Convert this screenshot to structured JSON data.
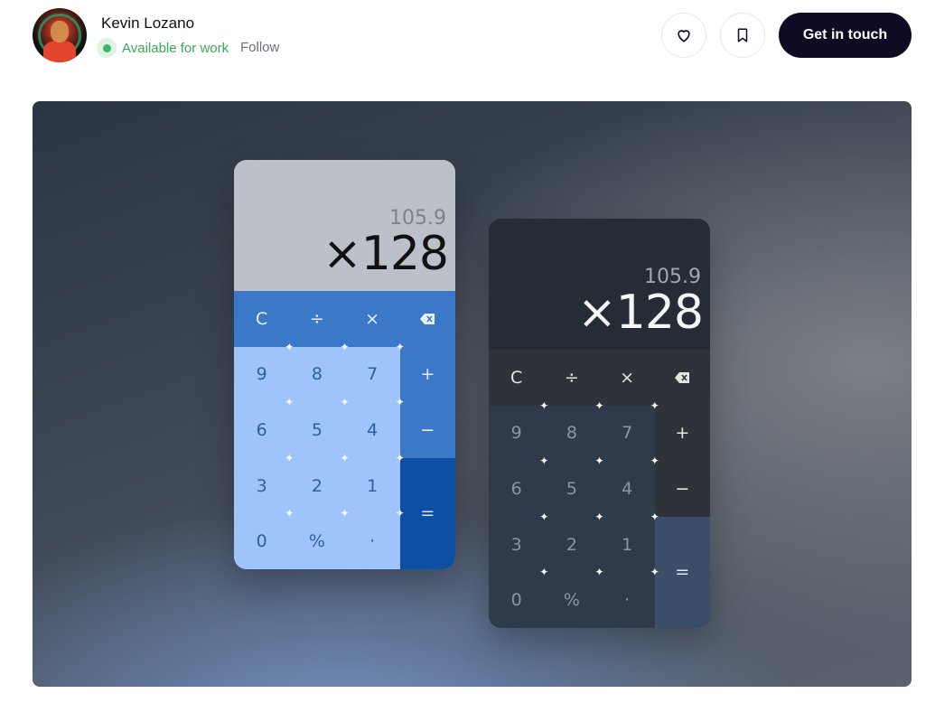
{
  "header": {
    "designer_name": "Kevin Lozano",
    "availability": "Available for work",
    "follow_label": "Follow",
    "cta_label": "Get in touch"
  },
  "shot": {
    "calc_light": {
      "previous": "105.9",
      "result": "×128",
      "keys": [
        "C",
        "÷",
        "×",
        "⌫",
        "9",
        "8",
        "7",
        "+",
        "6",
        "5",
        "4",
        "−",
        "3",
        "2",
        "1",
        "=",
        "0",
        "%",
        "·"
      ]
    },
    "calc_dark": {
      "previous": "105.9",
      "result": "×128",
      "keys": [
        "C",
        "÷",
        "×",
        "⌫",
        "9",
        "8",
        "7",
        "+",
        "6",
        "5",
        "4",
        "−",
        "3",
        "2",
        "1",
        "=",
        "0",
        "%",
        "·"
      ]
    }
  },
  "colors": {
    "available_green": "#3aa757",
    "cta_bg": "#0d0c22",
    "light_key": "#9fc4fb",
    "light_operator": "#3b78c7",
    "light_equals": "#0c4fa3",
    "dark_key": "#2f3a4a",
    "dark_operator": "#2f3238",
    "dark_equals": "#3b4e69"
  },
  "icons": [
    "heart-icon",
    "bookmark-icon",
    "backspace-icon",
    "status-dot-icon"
  ]
}
